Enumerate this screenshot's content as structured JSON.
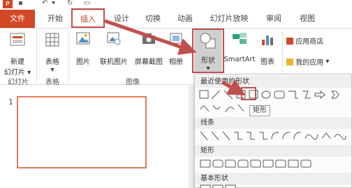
{
  "tabs": {
    "file": "文件",
    "home": "开始",
    "insert": "插入",
    "design": "设计",
    "transitions": "切换",
    "animations": "动画",
    "slideshow": "幻灯片放映",
    "review": "审阅",
    "view": "视图"
  },
  "ribbon": {
    "new_slide": "新建",
    "new_slide_sub": "幻灯片 ▾",
    "table": "表格",
    "table_sub": "▾",
    "picture": "图片",
    "online_picture": "联机图片",
    "screenshot": "屏幕截图",
    "album": "相册",
    "shapes": "形状",
    "shapes_sub": "▾",
    "smartart": "SmartArt",
    "chart": "图表",
    "app_store": "应用商店",
    "my_apps": "我的应用",
    "my_apps_arrow": "▾",
    "group_slides": "幻灯片",
    "group_tables": "表格",
    "group_images": "图像"
  },
  "slides": {
    "number": "1"
  },
  "dropdown": {
    "recent": "最近使用的形状",
    "lines": "线条",
    "rectangles": "矩形",
    "basic": "基本形状",
    "tooltip": "矩形"
  },
  "colors": {
    "accent": "#d24726",
    "highlight": "#c0504d",
    "thumb_border": "#e07a5f"
  }
}
